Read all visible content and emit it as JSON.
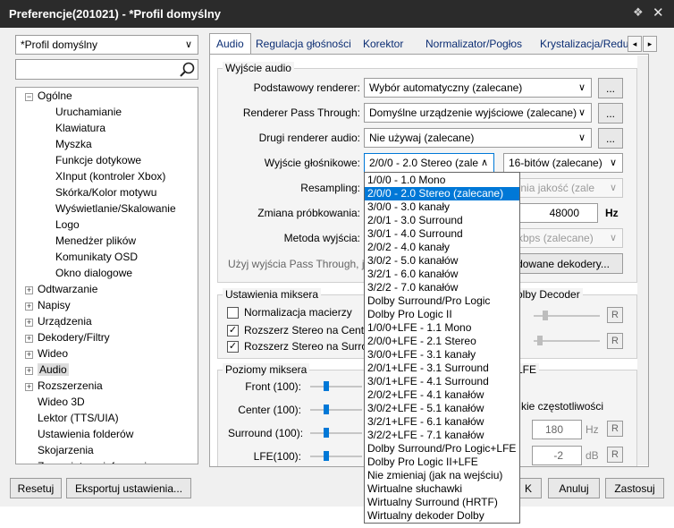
{
  "window": {
    "title": "Preferencje(201021) - *Profil domyślny",
    "pin_icon": "pin-icon",
    "close_icon": "close-icon"
  },
  "profile": {
    "selected": "*Profil domyślny"
  },
  "search": {
    "value": "",
    "icon": "search-icon"
  },
  "tree": [
    {
      "label": "Ogólne",
      "expander": "−",
      "level": 0
    },
    {
      "label": "Uruchamianie",
      "level": 1
    },
    {
      "label": "Klawiatura",
      "level": 1
    },
    {
      "label": "Myszka",
      "level": 1
    },
    {
      "label": "Funkcje dotykowe",
      "level": 1
    },
    {
      "label": "XInput (kontroler Xbox)",
      "level": 1
    },
    {
      "label": "Skórka/Kolor motywu",
      "level": 1
    },
    {
      "label": "Wyświetlanie/Skalowanie",
      "level": 1
    },
    {
      "label": "Logo",
      "level": 1
    },
    {
      "label": "Menedżer plików",
      "level": 1
    },
    {
      "label": "Komunikaty OSD",
      "level": 1
    },
    {
      "label": "Okno dialogowe",
      "level": 1
    },
    {
      "label": "Odtwarzanie",
      "expander": "+",
      "level": 0
    },
    {
      "label": "Napisy",
      "expander": "+",
      "level": 0
    },
    {
      "label": "Urządzenia",
      "expander": "+",
      "level": 0
    },
    {
      "label": "Dekodery/Filtry",
      "expander": "+",
      "level": 0
    },
    {
      "label": "Wideo",
      "expander": "+",
      "level": 0
    },
    {
      "label": "Audio",
      "expander": "+",
      "level": 0,
      "selected": true
    },
    {
      "label": "Rozszerzenia",
      "expander": "+",
      "level": 0
    },
    {
      "label": "Wideo 3D",
      "level": 0
    },
    {
      "label": "Lektor (TTS/UIA)",
      "level": 0
    },
    {
      "label": "Ustawienia folderów",
      "level": 0
    },
    {
      "label": "Skojarzenia",
      "level": 0
    },
    {
      "label": "Zapamiętane informacje",
      "expander": "+",
      "level": 0
    }
  ],
  "tabs": [
    "Audio",
    "Regulacja głośności",
    "Korektor",
    "Normalizator/Pogłos",
    "Krystalizacja/Redu"
  ],
  "tab_arrows": {
    "left": "◂",
    "right": "▸"
  },
  "audio_output": {
    "group_title": "Wyjście audio",
    "primary_renderer_label": "Podstawowy renderer:",
    "primary_renderer_value": "Wybór automatyczny (zalecane)",
    "passthrough_label": "Renderer Pass Through:",
    "passthrough_value": "Domyślne urządzenie wyjściowe (zalecane)",
    "second_renderer_label": "Drugi renderer audio:",
    "second_renderer_value": "Nie używaj (zalecane)",
    "speaker_label": "Wyjście głośnikowe:",
    "speaker_value": "2/0/0 - 2.0 Stereo (zale",
    "bits_value": "16-bitów (zalecane)",
    "resampling_label": "Resampling:",
    "resampling_value": "ednia jakość (zale",
    "sample_rate_label": "Zmiana próbkowania:",
    "sample_rate_value": "48000",
    "sample_rate_unit": "Hz",
    "output_method_label": "Metoda wyjścia:",
    "output_method_value": "0 kbps (zalecane)",
    "passthrough_note": "Użyj wyjścia Pass Through, je",
    "decoders_button": "dowane dekodery...",
    "ellipsis": "..."
  },
  "mixer": {
    "group_title": "Ustawienia miksera",
    "normalize": "Normalizacja macierzy",
    "widen_center": "Rozszerz Stereo na Center",
    "widen_surround": "Rozszerz Stereo na Surroun",
    "normalize_checked": false,
    "widen_center_checked": true,
    "widen_surround_checked": true,
    "dolby_group_title": "olby Decoder",
    "r_label": "R"
  },
  "levels": {
    "group_title": "Poziomy miksera",
    "front": "Front (100):",
    "center": "Center (100):",
    "surround": "Surround (100):",
    "lfe": "LFE(100):",
    "lfe_group_title": "LFE",
    "freq_label": "kie częstotliwości",
    "freq_value": "180",
    "freq_unit": "Hz",
    "gain_value": "-2",
    "gain_unit": "dB"
  },
  "speaker_dropdown": {
    "selected_index": 1,
    "options": [
      "1/0/0 - 1.0 Mono",
      "2/0/0 - 2.0 Stereo (zalecane)",
      "3/0/0 - 3.0 kanały",
      "2/0/1 - 3.0 Surround",
      "3/0/1 - 4.0 Surround",
      "2/0/2 - 4.0 kanały",
      "3/0/2 - 5.0 kanałów",
      "3/2/1 - 6.0 kanałów",
      "3/2/2 - 7.0 kanałów",
      "Dolby Surround/Pro Logic",
      "Dolby Pro Logic II",
      "1/0/0+LFE - 1.1 Mono",
      "2/0/0+LFE - 2.1 Stereo",
      "3/0/0+LFE - 3.1 kanały",
      "2/0/1+LFE - 3.1 Surround",
      "3/0/1+LFE - 4.1 Surround",
      "2/0/2+LFE - 4.1 kanałów",
      "3/0/2+LFE - 5.1 kanałów",
      "3/2/1+LFE - 6.1 kanałów",
      "3/2/2+LFE - 7.1 kanałów",
      "Dolby Surround/Pro Logic+LFE",
      "Dolby Pro Logic II+LFE",
      "Nie zmieniaj (jak na wejściu)",
      "Wirtualne słuchawki",
      "Wirtualny Surround (HRTF)",
      "Wirtualny dekoder Dolby"
    ]
  },
  "footer": {
    "reset": "Resetuj",
    "export": "Eksportuj ustawienia...",
    "ok": "K",
    "cancel": "Anuluj",
    "apply": "Zastosuj"
  }
}
